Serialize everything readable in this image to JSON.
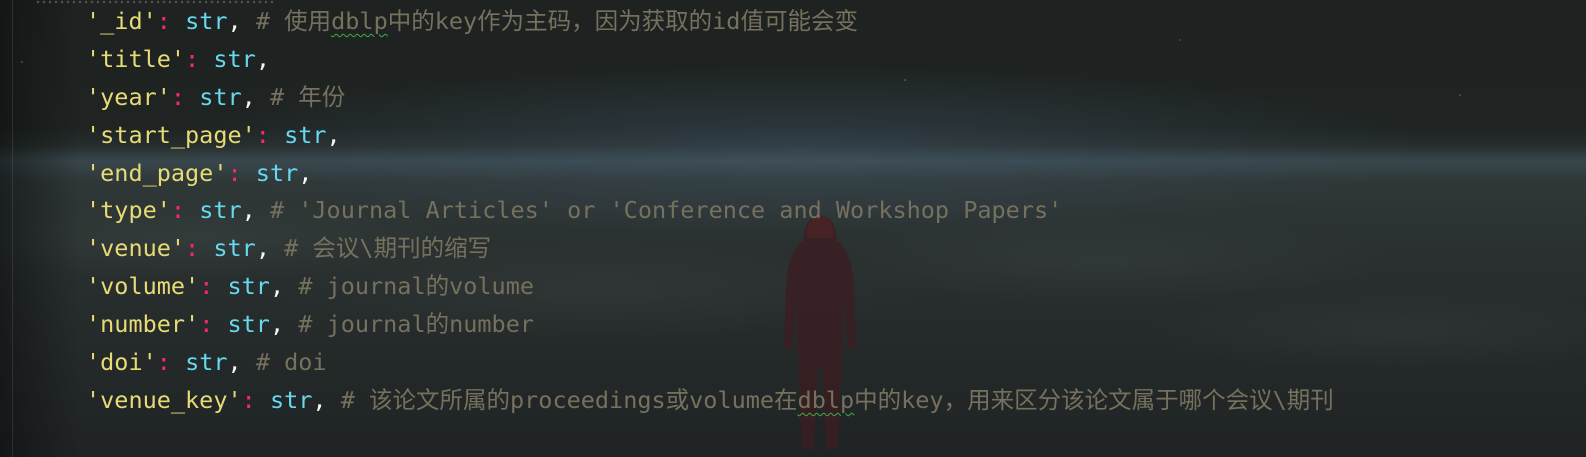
{
  "editor": {
    "lines": [
      {
        "key": "'_id'",
        "colon": ":",
        "type": "str",
        "comma": ",",
        "comment_pre": "# 使用",
        "comment_squig": "dblp",
        "comment_post": "中的key作为主码，因为获取的id值可能会变"
      },
      {
        "key": "'title'",
        "colon": ":",
        "type": "str",
        "comma": ",",
        "comment_pre": "",
        "comment_squig": "",
        "comment_post": ""
      },
      {
        "key": "'year'",
        "colon": ":",
        "type": "str",
        "comma": ",",
        "comment_pre": "# 年份",
        "comment_squig": "",
        "comment_post": ""
      },
      {
        "key": "'start_page'",
        "colon": ":",
        "type": "str",
        "comma": ",",
        "comment_pre": "",
        "comment_squig": "",
        "comment_post": ""
      },
      {
        "key": "'end_page'",
        "colon": ":",
        "type": "str",
        "comma": ",",
        "comment_pre": "",
        "comment_squig": "",
        "comment_post": ""
      },
      {
        "key": "'type'",
        "colon": ":",
        "type": "str",
        "comma": ",",
        "comment_pre": "# 'Journal Articles' or 'Conference and Workshop Papers'",
        "comment_squig": "",
        "comment_post": ""
      },
      {
        "key": "'venue'",
        "colon": ":",
        "type": "str",
        "comma": ",",
        "comment_pre": "# 会议\\期刊的缩写",
        "comment_squig": "",
        "comment_post": ""
      },
      {
        "key": "'volume'",
        "colon": ":",
        "type": "str",
        "comma": ",",
        "comment_pre": "# journal的volume",
        "comment_squig": "",
        "comment_post": ""
      },
      {
        "key": "'number'",
        "colon": ":",
        "type": "str",
        "comma": ",",
        "comment_pre": "# journal的number",
        "comment_squig": "",
        "comment_post": ""
      },
      {
        "key": "'doi'",
        "colon": ":",
        "type": "str",
        "comma": ",",
        "comment_pre": "# doi",
        "comment_squig": "",
        "comment_post": ""
      },
      {
        "key": "'venue_key'",
        "colon": ":",
        "type": "str",
        "comma": ",",
        "comment_pre": "# 该论文所属的proceedings或volume在",
        "comment_squig": "dblp",
        "comment_post": "中的key，用来区分该论文属于哪个会议\\期刊"
      }
    ]
  },
  "theme": {
    "key_color": "#e6db74",
    "colon_color": "#f92672",
    "type_color": "#66d9ef",
    "comment_color": "#75715e",
    "spellcheck_color": "#3fae45"
  }
}
